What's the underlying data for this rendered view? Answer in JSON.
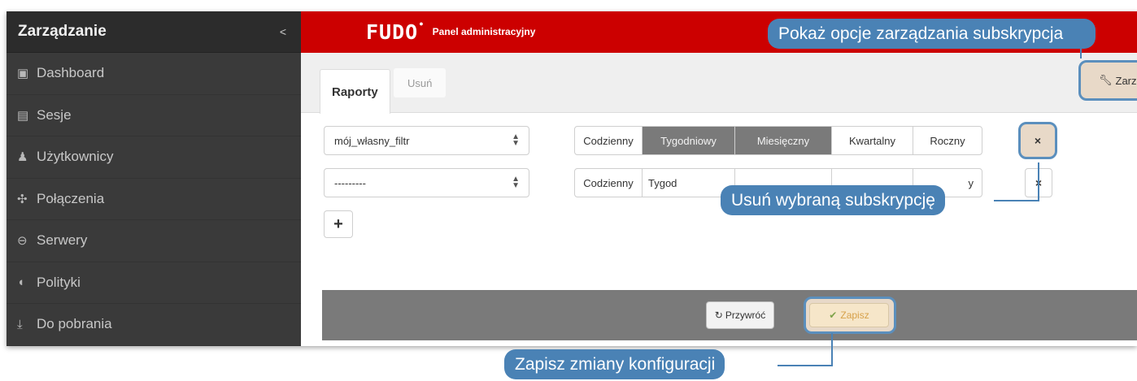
{
  "sidebar": {
    "title": "Zarządzanie",
    "collapse_icon": "chevron-left-icon",
    "items": [
      {
        "label": "Dashboard",
        "icon": "dashboard-icon",
        "glyph": "▣"
      },
      {
        "label": "Sesje",
        "icon": "film-icon",
        "glyph": "▤"
      },
      {
        "label": "Użytkownicy",
        "icon": "users-icon",
        "glyph": "♟"
      },
      {
        "label": "Połączenia",
        "icon": "connections-icon",
        "glyph": "✣"
      },
      {
        "label": "Serwery",
        "icon": "server-icon",
        "glyph": "⊖"
      },
      {
        "label": "Polityki",
        "icon": "shield-icon",
        "glyph": "◖"
      },
      {
        "label": "Do pobrania",
        "icon": "download-icon",
        "glyph": "⤓"
      }
    ]
  },
  "header": {
    "logo": "FUDO",
    "subtitle": "Panel administracyjny",
    "brand_color": "#cc0000"
  },
  "tabs": {
    "active": "Raporty",
    "inactive": "Usuń"
  },
  "manage_button": {
    "label": "Zarz",
    "icon": "wrench-icon"
  },
  "subscriptions": [
    {
      "filter": "mój_własny_filtr",
      "periods": [
        {
          "label": "Codzienny",
          "active": false
        },
        {
          "label": "Tygodniowy",
          "active": true
        },
        {
          "label": "Miesięczny",
          "active": true
        },
        {
          "label": "Kwartalny",
          "active": false
        },
        {
          "label": "Roczny",
          "active": false
        }
      ],
      "delete_glyph": "×"
    },
    {
      "filter": "---------",
      "periods_visible": [
        {
          "label": "Codzienny"
        },
        {
          "label": "Tygod"
        },
        {
          "label": "y"
        }
      ],
      "delete_glyph": "×"
    }
  ],
  "add_button": "+",
  "footer": {
    "restore_label": "Przywróć",
    "restore_icon": "refresh-icon",
    "save_label": "Zapisz",
    "save_icon": "check-icon"
  },
  "callouts": {
    "manage": "Pokaż opcje zarządzania subskrypcja",
    "delete": "Usuń wybraną subskrypcję",
    "save": "Zapisz zmiany konfiguracji",
    "color": "#4a82b5"
  }
}
